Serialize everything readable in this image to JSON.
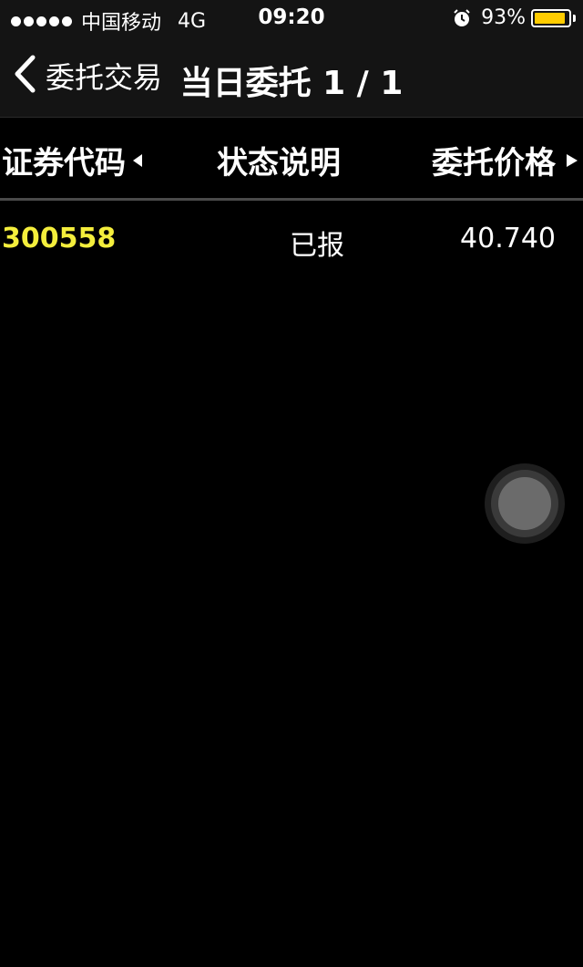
{
  "status_bar": {
    "carrier": "中国移动",
    "network": "4G",
    "time": "09:20",
    "battery_percent_text": "93%",
    "battery_level": 0.93,
    "alarm_icon": "alarm-icon"
  },
  "nav": {
    "back_label": "委托交易",
    "title": "当日委托 1 / 1"
  },
  "table": {
    "columns": [
      "证券代码",
      "状态说明",
      "委托价格"
    ],
    "rows": [
      {
        "code": "300558",
        "status": "已报",
        "price": "40.740"
      }
    ]
  },
  "colors": {
    "background": "#000000",
    "bar": "#141414",
    "code_yellow": "#f4ee3c",
    "battery_yellow": "#ffcc00"
  }
}
